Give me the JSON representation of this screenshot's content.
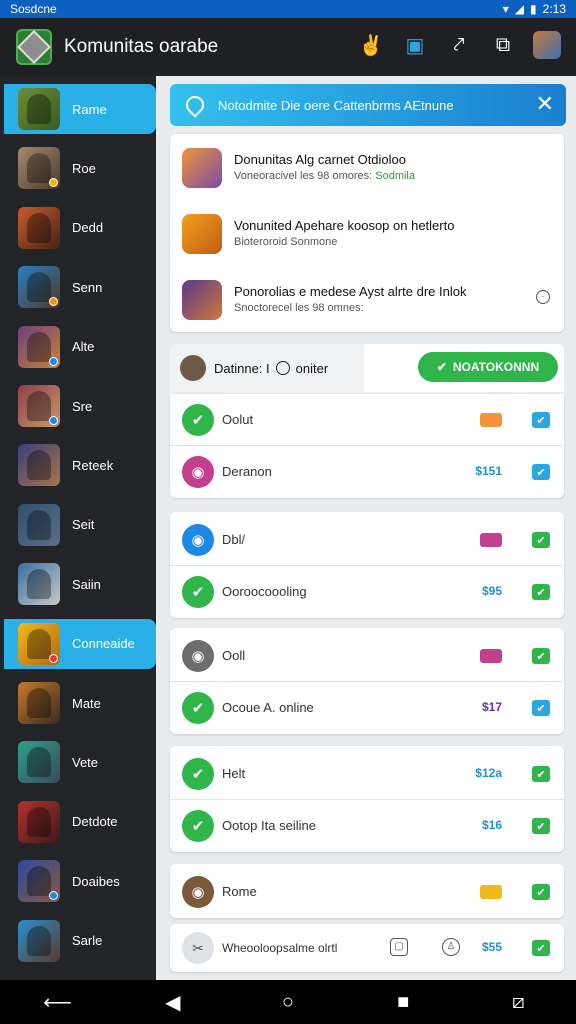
{
  "status": {
    "carrier": "Sosdcne",
    "time": "2:13"
  },
  "appbar": {
    "title": "Komunitas oarabe",
    "icons": [
      "game-controller-icon",
      "clipboard-icon",
      "share-icon",
      "edit-icon",
      "avatar"
    ]
  },
  "sidebar": {
    "items": [
      {
        "label": "Rame",
        "colors": [
          "#6a8f3a",
          "#3b5a1f"
        ],
        "badge": ""
      },
      {
        "label": "Roe",
        "colors": [
          "#a68b6e",
          "#4a3b2e"
        ],
        "badge": "#f4b400"
      },
      {
        "label": "Dedd",
        "colors": [
          "#c75b2f",
          "#4a2416"
        ],
        "badge": ""
      },
      {
        "label": "Senn",
        "colors": [
          "#2a7fc0",
          "#4e3a2a"
        ],
        "badge": "#ff8f00"
      },
      {
        "label": "Alte",
        "colors": [
          "#6b3f7a",
          "#c7843a"
        ],
        "badge": "#1e88e5"
      },
      {
        "label": "Sre",
        "colors": [
          "#8e3e4a",
          "#c49a6c"
        ],
        "badge": "#1e88e5"
      },
      {
        "label": "Reteek",
        "colors": [
          "#3a3f7a",
          "#a8754a"
        ],
        "badge": ""
      },
      {
        "label": "Seit",
        "colors": [
          "#2f4f6f",
          "#5a6f8a"
        ],
        "badge": ""
      },
      {
        "label": "Saiin",
        "colors": [
          "#3a6f9f",
          "#c8c8c8"
        ],
        "badge": ""
      },
      {
        "label": "Conneaide",
        "colors": [
          "#f2b81c",
          "#b06a10"
        ],
        "badge": "#e53935"
      },
      {
        "label": "Mate",
        "colors": [
          "#c77a2f",
          "#3a2a1f"
        ],
        "badge": ""
      },
      {
        "label": "Vete",
        "colors": [
          "#2f9f8a",
          "#3a4a5a"
        ],
        "badge": ""
      },
      {
        "label": "Detdote",
        "colors": [
          "#b5322e",
          "#3a1a1a"
        ],
        "badge": ""
      },
      {
        "label": "Doaibes",
        "colors": [
          "#2a4a9f",
          "#8a5a3a"
        ],
        "badge": "#1e88e5"
      },
      {
        "label": "Sarle",
        "colors": [
          "#2a8fcf",
          "#5a3a2a"
        ],
        "badge": ""
      }
    ]
  },
  "banner": {
    "text": "Notodmite Die oere Cattenbrms AEtnune"
  },
  "feed": [
    {
      "title": "Donunitas Alg carnet  Otdioloo",
      "sub": "Voneoracivel les 98 omores: ",
      "sub_green": "Sodmila",
      "colors": [
        "#f0953b",
        "#7a4aa8"
      ]
    },
    {
      "title": "Vonunited Apehare koosop on hetlerto",
      "sub": "Bioteroroid Sonmone",
      "sub_green": "",
      "colors": [
        "#f2a31f",
        "#c25a12"
      ]
    },
    {
      "title": "Ponorolias e medese  Ayst alrte dre Inlok",
      "sub": "Snoctorecel les 98 omnes: ",
      "sub_green": "",
      "colors": [
        "#5a3a8a",
        "#d0763a"
      ]
    }
  ],
  "filter": {
    "label": "Datinne: I",
    "status": "oniter",
    "button": "NOATOKONNN"
  },
  "groups": [
    {
      "rows": [
        {
          "label": "Oolut",
          "icon_color": "#2fb54a",
          "price": "",
          "tag": "#f0953b",
          "check": "#2aa6e0"
        },
        {
          "label": "Deranon",
          "icon_color": "#c2408f",
          "price": "$151",
          "tag": "",
          "check": "#2aa6e0"
        }
      ]
    },
    {
      "rows": [
        {
          "label": "Dbl/",
          "icon_color": "#1e88e5",
          "price": "",
          "tag": "#c2408f",
          "check": "#2fb54a"
        },
        {
          "label": "Ooroocoooling",
          "icon_color": "#2fb54a",
          "price": "$95",
          "tag": "",
          "check": "#2fb54a"
        }
      ]
    },
    {
      "rows": [
        {
          "label": "Ooll",
          "icon_color": "#6d6d6d",
          "price": "",
          "tag": "#c2408f",
          "check": "#2fb54a"
        },
        {
          "label": "Ocoue A. online",
          "icon_color": "#2fb54a",
          "price": "$17",
          "tag": "",
          "check": "#2aa6e0"
        }
      ]
    },
    {
      "rows": [
        {
          "label": "Helt",
          "icon_color": "#2fb54a",
          "price": "$12a",
          "tag": "#c2408f",
          "check": "#2fb54a"
        },
        {
          "label": "Ootop Ita seiline",
          "icon_color": "#2fb54a",
          "price": "$16",
          "tag": "",
          "check": "#2fb54a"
        }
      ]
    },
    {
      "rows": [
        {
          "label": "Rome",
          "icon_color": "#7a5a3a",
          "price": "",
          "tag": "#f2b81c",
          "check": "#2fb54a"
        }
      ]
    }
  ],
  "bottom": {
    "label": "Wheooloopsalme olrtl",
    "price": "$55"
  },
  "price_colors": {
    "blue": "#1f8fd6",
    "purple": "#6a2fb0"
  }
}
